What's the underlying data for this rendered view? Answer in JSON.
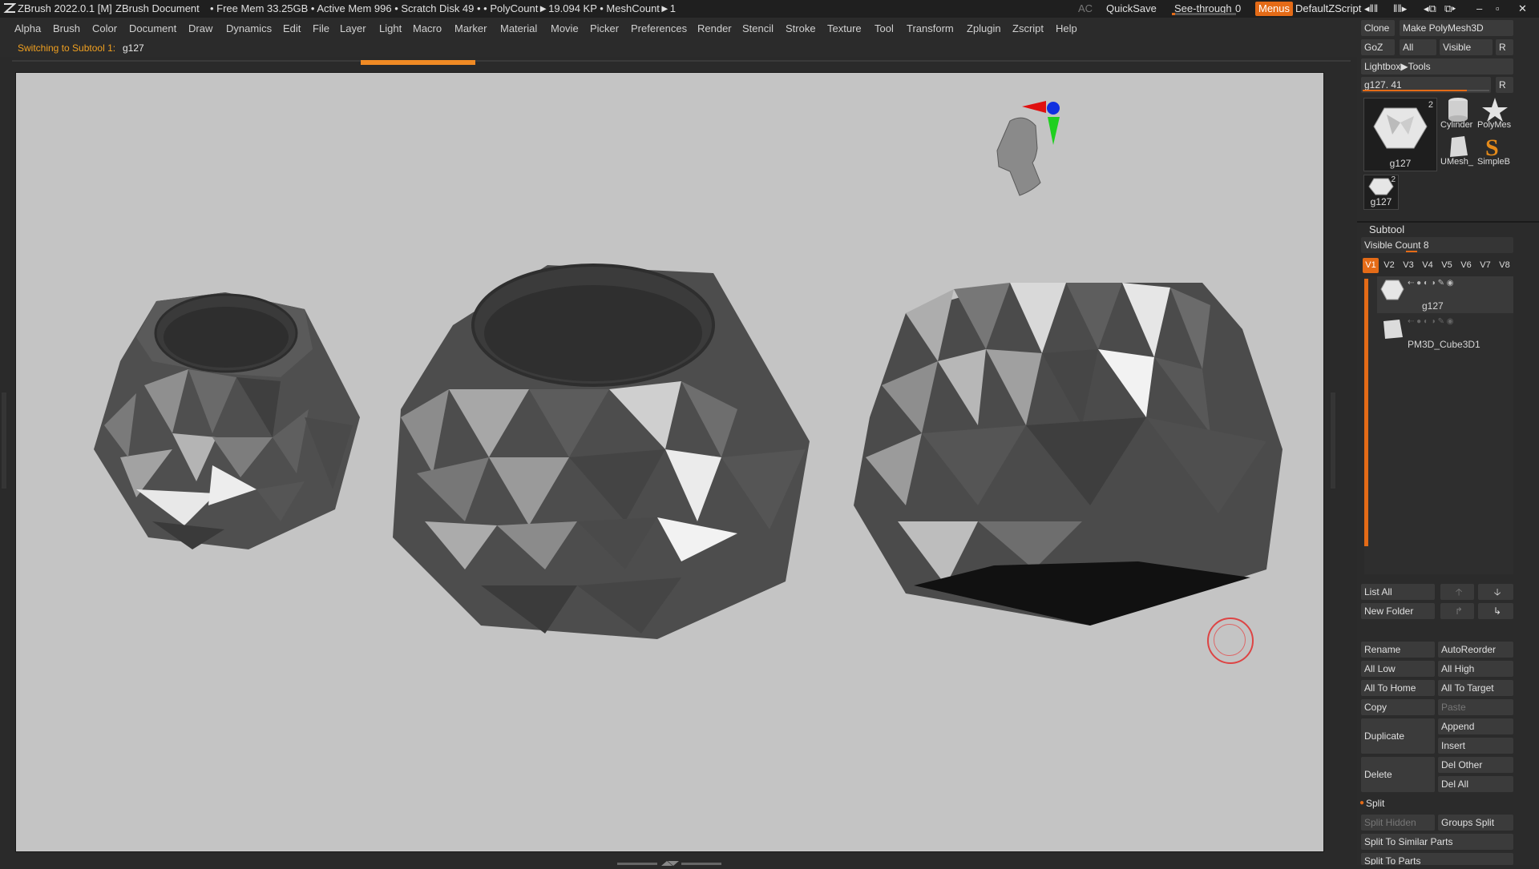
{
  "titlebar": {
    "app": "ZBrush 2022.0.1 [M]",
    "document": "ZBrush Document",
    "stats": "• Free Mem 33.25GB • Active Mem 996 • Scratch Disk 49 •  • PolyCount►19.094 KP  • MeshCount►1",
    "ac": "AC",
    "quicksave": "QuickSave",
    "seethrough_label": "See-through",
    "seethrough_value": "0",
    "seethrough_level": 0.0,
    "menus": "Menus",
    "script": "DefaultZScript"
  },
  "menubar": [
    "Alpha",
    "Brush",
    "Color",
    "Document",
    "Draw",
    "Dynamics",
    "Edit",
    "File",
    "Layer",
    "Light",
    "Macro",
    "Marker",
    "Material",
    "Movie",
    "Picker",
    "Preferences",
    "Render",
    "Stencil",
    "Stroke",
    "Texture",
    "Tool",
    "Transform",
    "Zplugin",
    "Zscript",
    "Help"
  ],
  "status": {
    "label": "Switching to Subtool 1:",
    "value": "g127"
  },
  "colors": {
    "accent": "#e46b17",
    "canvas": "#c4c4c4"
  },
  "tool": {
    "clone": "Clone",
    "make_polymesh": "Make PolyMesh3D",
    "goz": "GoZ",
    "all": "All",
    "visible": "Visible",
    "r": "R",
    "lightbox": "Lightbox▶Tools",
    "slider_label": "g127. 41",
    "slider_level": 0.82,
    "main_thumb": {
      "name": "g127",
      "badge": "2"
    },
    "thumbs": [
      {
        "name": "Cylinder",
        "icon": "cylinder-icon"
      },
      {
        "name": "PolyMes",
        "icon": "star-icon"
      },
      {
        "name": "UMesh_",
        "icon": "umesh-icon"
      },
      {
        "name": "SimpleB",
        "icon": "simplebrush-icon"
      }
    ],
    "small_thumb": {
      "name": "g127",
      "badge": "2"
    }
  },
  "subtool": {
    "header": "Subtool",
    "visible_count": "Visible Count 8",
    "versions": [
      "V1",
      "V2",
      "V3",
      "V4",
      "V5",
      "V6",
      "V7",
      "V8"
    ],
    "items": [
      {
        "name": "g127"
      },
      {
        "name": "PM3D_Cube3D1"
      }
    ],
    "list_all": "List All",
    "new_folder": "New Folder",
    "rename": "Rename",
    "autoreorder": "AutoReorder",
    "all_low": "All Low",
    "all_high": "All High",
    "all_to_home": "All To Home",
    "all_to_target": "All To Target",
    "copy": "Copy",
    "paste": "Paste",
    "duplicate": "Duplicate",
    "append": "Append",
    "insert": "Insert",
    "delete": "Delete",
    "del_other": "Del Other",
    "del_all": "Del All",
    "split": "Split",
    "split_hidden": "Split Hidden",
    "groups_split": "Groups Split",
    "split_similar": "Split To Similar Parts",
    "split_parts": "Split To Parts"
  }
}
